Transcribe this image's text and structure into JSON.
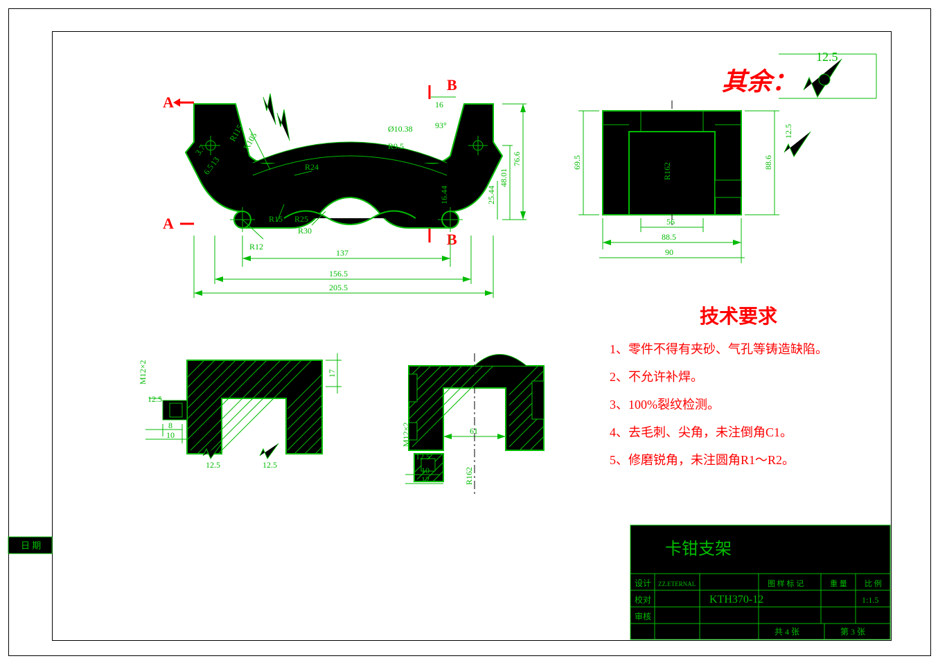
{
  "frame": {
    "date_label": "日 期",
    "qiyu": "其余：",
    "roughness_value": "12.5"
  },
  "sections": {
    "A": "A",
    "B": "B"
  },
  "front_dims": {
    "d137": "137",
    "d156_5": "156.5",
    "d205_5": "205.5",
    "d16_top": "16",
    "d93deg": "93°",
    "d76_6": "76.6",
    "d48_01": "48.01",
    "d25_44": "25.44",
    "d16_44": "16.44",
    "r12": "R12",
    "r15": "R15",
    "r25": "R25",
    "r30": "R30",
    "r24": "R24",
    "r95": "R9.5",
    "r115": "R115",
    "r105": "R105",
    "dia1038": "Ø10.38",
    "d37": "3.7",
    "d13": "13",
    "d65": "6.5"
  },
  "side_dims": {
    "d90": "90",
    "d88_5": "88.5",
    "d56": "56",
    "r162": "R162",
    "d69_5": "69.5",
    "d88_6": "88.6",
    "surf125": "12.5"
  },
  "secA": {
    "m12x2": "M12×2",
    "d12_5": "12.5",
    "d8": "8",
    "d10": "10",
    "d17": "17",
    "surf125": "12.5"
  },
  "secB": {
    "m12x2": "M12×2",
    "d12_5": "12.5",
    "d10": "10",
    "d12": "12",
    "d61": "61",
    "r162": "R162"
  },
  "tech": {
    "title": "技术要求",
    "items": [
      "1、零件不得有夹砂、气孔等铸造缺陷。",
      "2、不允许补焊。",
      "3、100%裂纹检测。",
      "4、去毛刺、尖角，未注倒角C1。",
      "5、修磨锐角，未注圆角R1～R2。"
    ]
  },
  "titleblock": {
    "part_name": "卡钳支架",
    "material": "KTH370-12",
    "design": "设计",
    "design_val": "ZZ.ETERNAL",
    "check": "校对",
    "approve": "审核",
    "drawing_mark": "图 样 标 记",
    "weight": "重 量",
    "scale": "比 例",
    "scale_val": "1:1.5",
    "sheets": "共 4 张",
    "sheet_no": "第 3 张"
  }
}
